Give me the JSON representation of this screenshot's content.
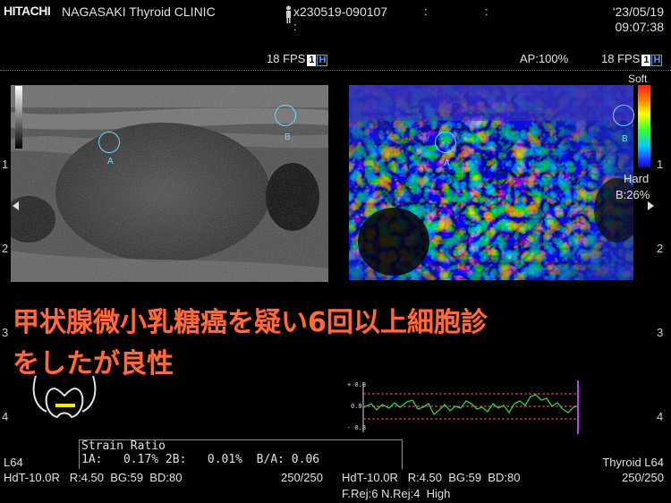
{
  "header": {
    "brand": "HITACHI",
    "clinic": "NAGASAKI Thyroid CLINIC",
    "patient_id": "x230519-090107",
    "colon1": ":",
    "colon2": ":",
    "colon3": ":",
    "date": "'23/05/19",
    "time": "09:07:38"
  },
  "left_panel": {
    "fps": "18 FPS",
    "badge1": "1",
    "badge2": "H",
    "depth_labels": [
      "1",
      "2",
      "3",
      "4"
    ],
    "markers": {
      "a": "A",
      "b": "B"
    }
  },
  "right_panel": {
    "ap": "AP:100%",
    "fps": "18 FPS",
    "badge1": "1",
    "badge2": "H",
    "scale_soft": "Soft",
    "scale_hard": "Hard",
    "b_percent": "B:26%",
    "depth_labels": [
      "1",
      "2",
      "3",
      "4"
    ],
    "markers": {
      "a": "A",
      "b": "B"
    }
  },
  "overlay": {
    "line1": "甲状腺微小乳糖癌を疑い6回以上細胞診",
    "line2": "をしたが良性"
  },
  "strain_graph": {
    "y_labels": [
      "+ 0.8",
      "0.0",
      "- 0.8"
    ]
  },
  "strain_ratio": {
    "title": "Strain Ratio",
    "row1": "1A:   0.17% 2B:   0.01%  B/A: 0.06"
  },
  "footer": {
    "left_probe": "L64",
    "left_params": "HdT-10.0R   R:4.50  BG:59  BD:80",
    "left_frames": "250/250",
    "mid_params": "HdT-10.0R   R:4.50  BG:59  BD:80",
    "mid_filters": "F.Rej:6 N.Rej:4  High",
    "right_preset": "Thyroid L64",
    "right_frames": "250/250"
  },
  "colors": {
    "overlay_text": "#ff6a3b",
    "marker": "#6fd2ff",
    "graph_line": "#36d336",
    "graph_guides": "#ff4d8c",
    "cursor": "#c03cff"
  }
}
